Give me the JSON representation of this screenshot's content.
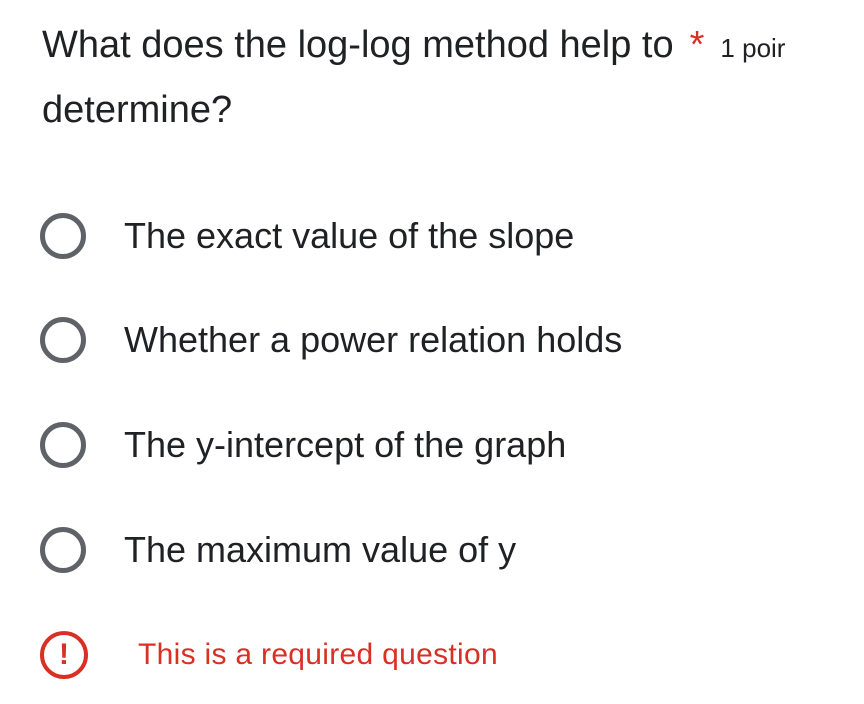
{
  "question": {
    "title_line1": "What does the log-log method help to",
    "title_line2": "determine?",
    "required_marker": "*",
    "points": "1 poir"
  },
  "options": [
    {
      "label": "The exact value of the slope",
      "selected": false
    },
    {
      "label": "Whether a power relation holds",
      "selected": false
    },
    {
      "label": "The y-intercept of the graph",
      "selected": false
    },
    {
      "label": "The maximum value of y",
      "selected": false
    }
  ],
  "error": {
    "icon": "!",
    "message": "This is a required question"
  },
  "colors": {
    "text": "#202124",
    "radio_border": "#5f6368",
    "required": "#d93025"
  }
}
